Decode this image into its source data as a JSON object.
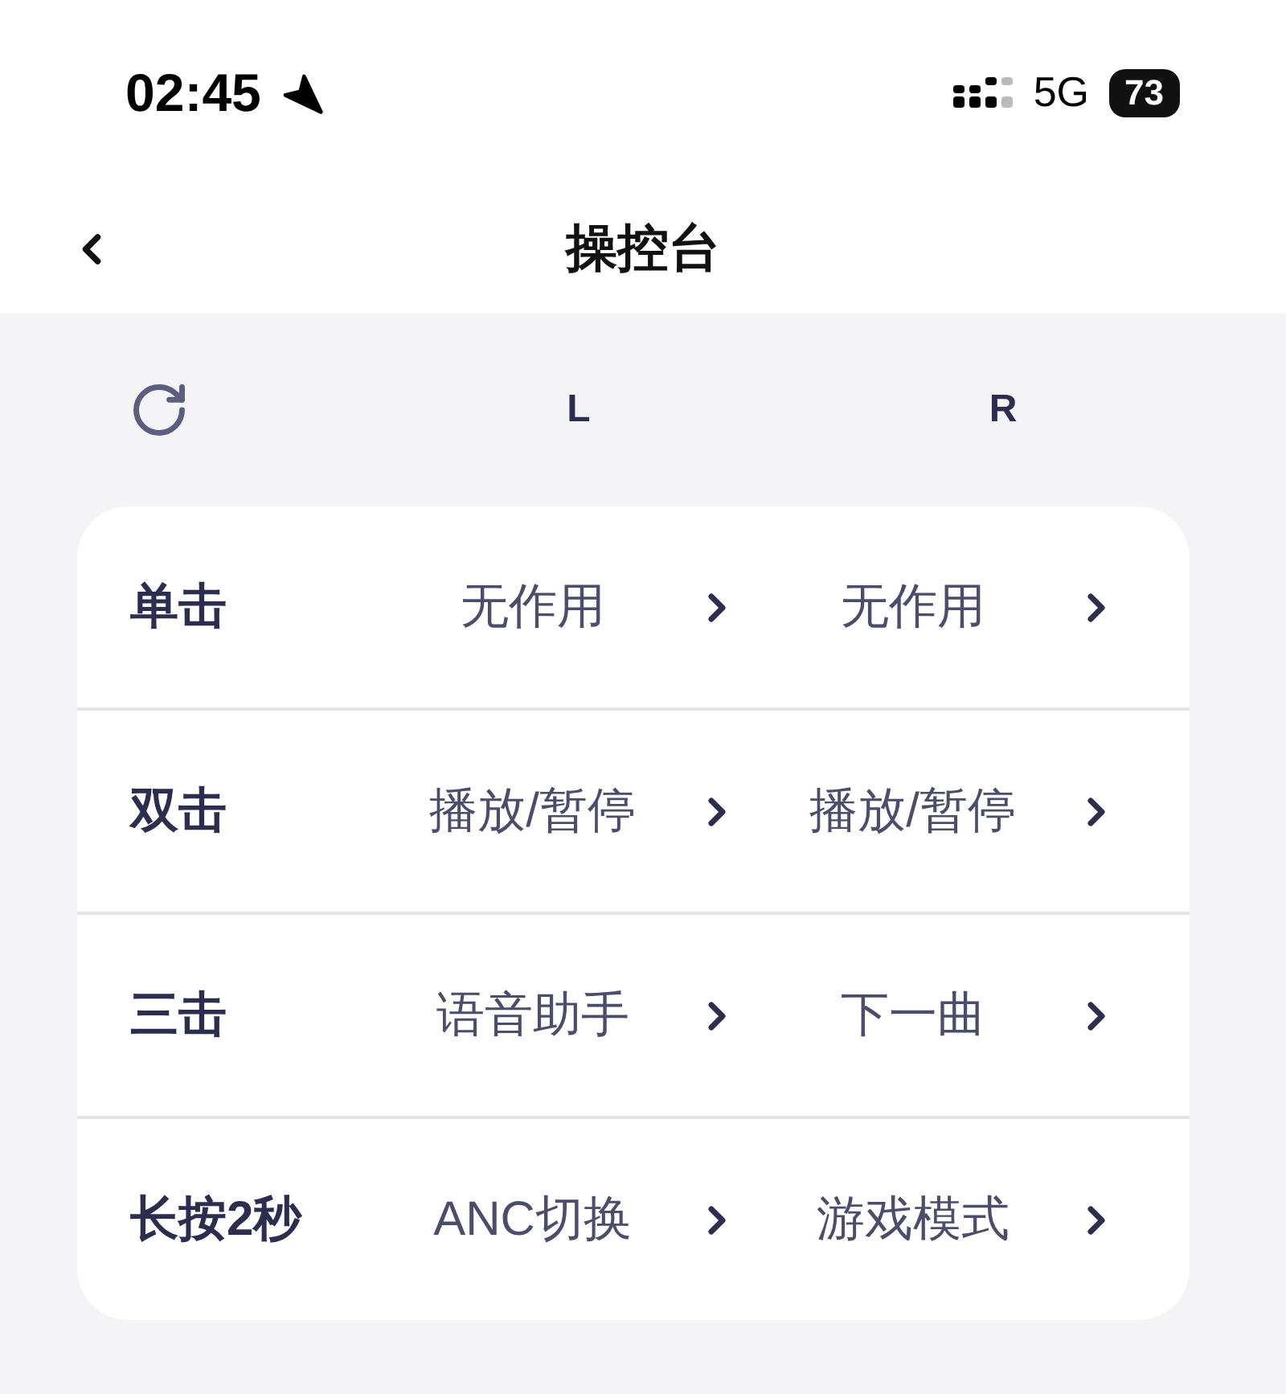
{
  "status_bar": {
    "time": "02:45",
    "network": "5G",
    "battery": "73"
  },
  "header": {
    "title": "操控台"
  },
  "columns": {
    "left": "L",
    "right": "R"
  },
  "rows": [
    {
      "gesture": "单击",
      "left": "无作用",
      "right": "无作用"
    },
    {
      "gesture": "双击",
      "left": "播放/暂停",
      "right": "播放/暂停"
    },
    {
      "gesture": "三击",
      "left": "语音助手",
      "right": "下一曲"
    },
    {
      "gesture": "长按2秒",
      "left": "ANC切换",
      "right": "游戏模式"
    }
  ]
}
